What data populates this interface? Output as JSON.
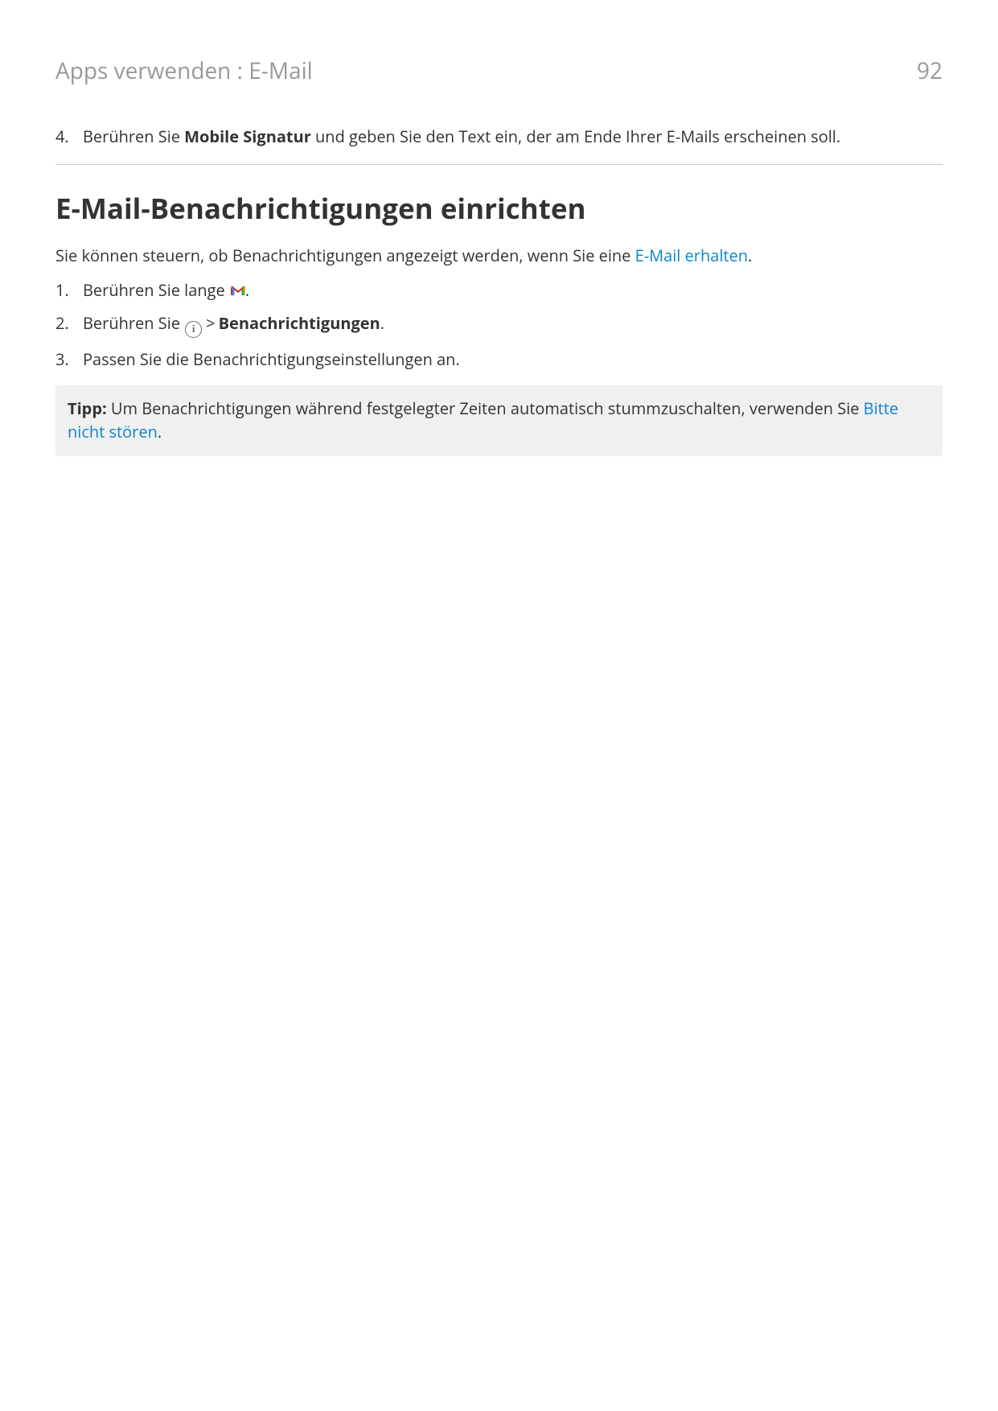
{
  "header": {
    "breadcrumb": "Apps verwenden : E-Mail",
    "page_number": "92"
  },
  "top_step": {
    "number": "4.",
    "text_before": "Berühren Sie ",
    "bold": "Mobile Signatur",
    "text_after": " und geben Sie den Text ein, der am Ende Ihrer E-Mails erscheinen soll."
  },
  "heading": "E-Mail-Benachrichtigungen einrichten",
  "intro": {
    "before_link": "Sie können steuern, ob Benachrichtigungen angezeigt werden, wenn Sie eine ",
    "link": "E-Mail erhalten",
    "after_link": "."
  },
  "steps": [
    {
      "number": "1.",
      "before_icon": "Berühren Sie lange ",
      "after_icon": "."
    },
    {
      "number": "2.",
      "before_icon": "Berühren Sie ",
      "gt": ">",
      "bold": "Benachrichtigungen",
      "after_bold": "."
    },
    {
      "number": "3.",
      "text": "Passen Sie die Benachrichtigungseinstellungen an."
    }
  ],
  "tip": {
    "label": "Tipp: ",
    "before_link": "Um Benachrichtigungen während festgelegter Zeiten automatisch stummzuschalten, verwenden Sie ",
    "link": "Bitte nicht stören",
    "after_link": "."
  },
  "icons": {
    "gmail": "gmail-icon",
    "info_letter": "i"
  }
}
